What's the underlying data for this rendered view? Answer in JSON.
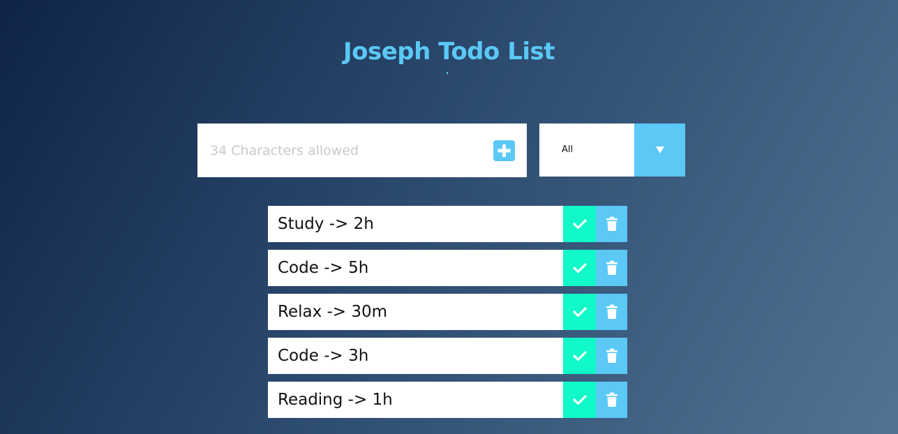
{
  "header": {
    "title": "Joseph Todo List"
  },
  "form": {
    "placeholder": "34 Characters allowed",
    "value": "",
    "add_icon": "plus-square-icon",
    "filter_selected": "All",
    "filter_icon": "triangle-down-icon"
  },
  "todos": [
    {
      "text": "Study -> 2h"
    },
    {
      "text": "Code -> 5h"
    },
    {
      "text": "Relax -> 30m"
    },
    {
      "text": "Code -> 3h"
    },
    {
      "text": "Reading -> 1h"
    }
  ],
  "item_icons": {
    "complete": "check-icon",
    "delete": "trash-icon"
  },
  "colors": {
    "accent": "#5bc8f5",
    "complete": "#11f9c8",
    "background_start": "#0f2447",
    "background_end": "#527494"
  }
}
